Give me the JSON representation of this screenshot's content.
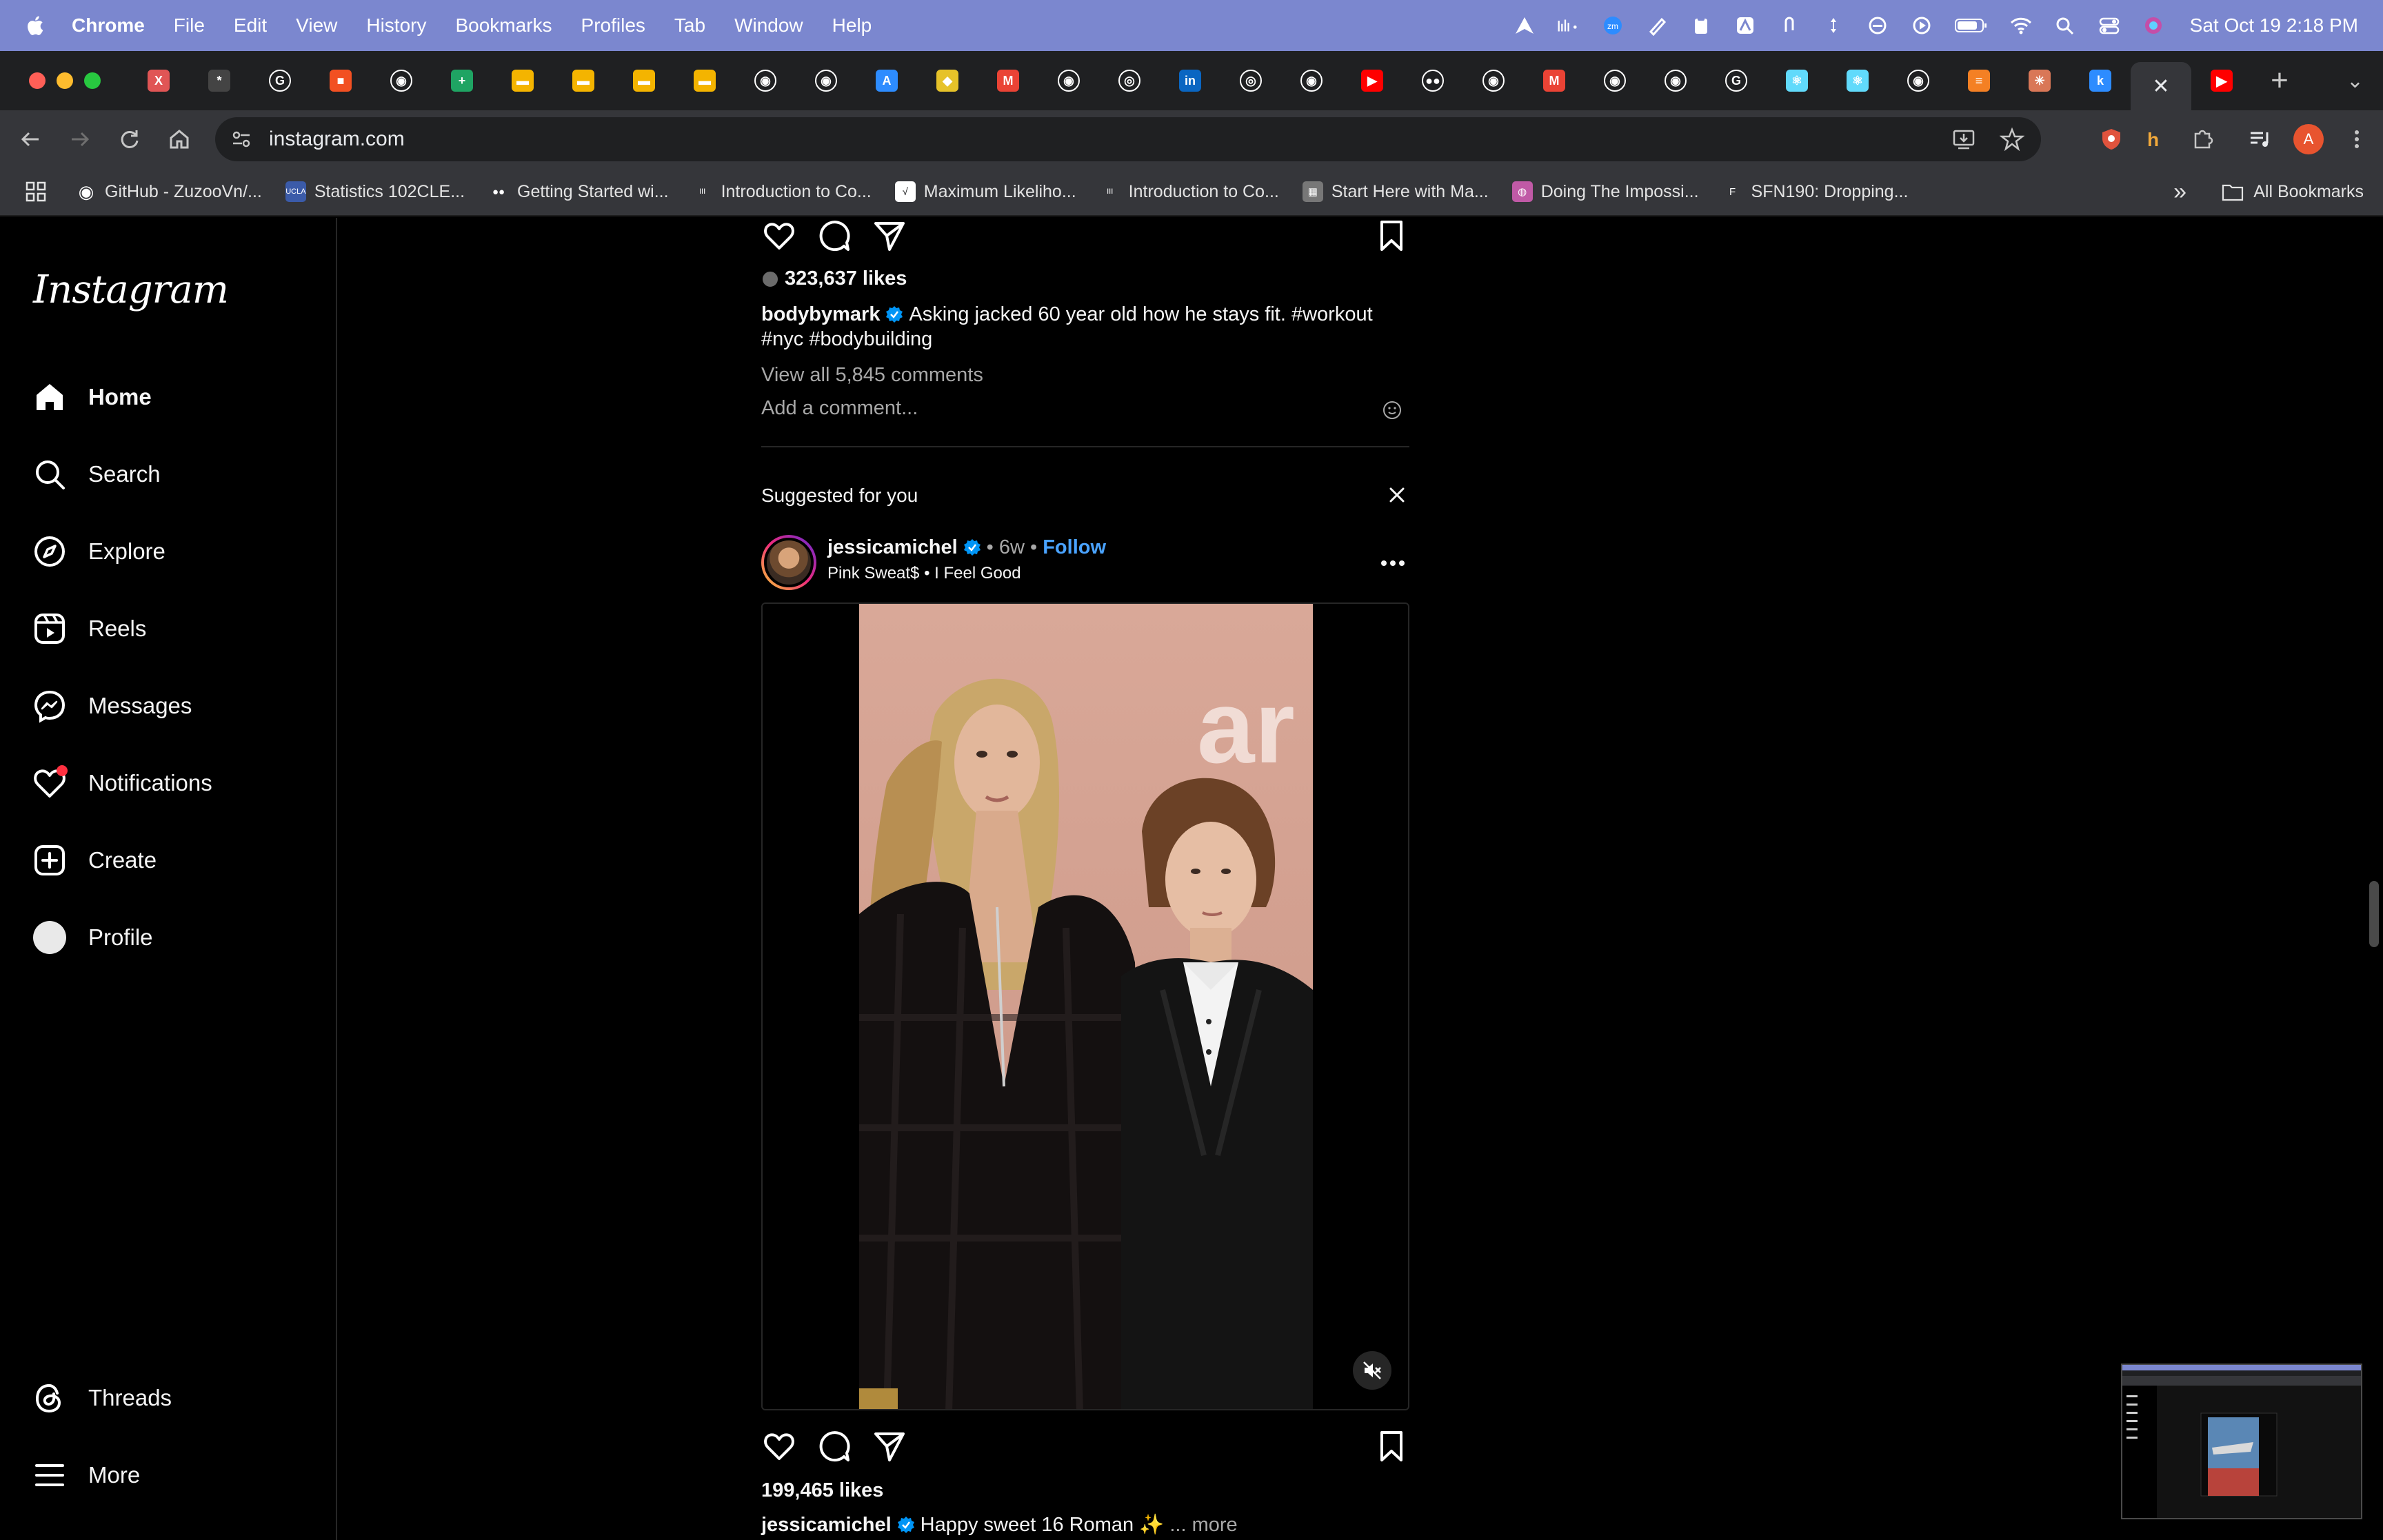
{
  "menubar": {
    "app_name": "Chrome",
    "items": [
      "File",
      "Edit",
      "View",
      "History",
      "Bookmarks",
      "Profiles",
      "Tab",
      "Window",
      "Help"
    ],
    "clock": "Sat Oct 19  2:18 PM",
    "status_icons": [
      "arrow-icon",
      "bars-icon",
      "zoom-icon",
      "pen-icon",
      "clipboard-icon",
      "maps-icon",
      "paperclip-icon",
      "updown-icon",
      "circle-icon",
      "play-icon",
      "battery-icon",
      "wifi-icon",
      "spotlight-icon",
      "control-center-icon",
      "siri-icon"
    ]
  },
  "tabs": {
    "favicons": [
      {
        "name": "x-tab",
        "color": "#e05555",
        "glyph": "X"
      },
      {
        "name": "spider-tab",
        "color": "#444444",
        "glyph": "*"
      },
      {
        "name": "google-tab",
        "color": "#ffffff",
        "glyph": "G"
      },
      {
        "name": "microsoft-tab",
        "color": "#f25022",
        "glyph": "■"
      },
      {
        "name": "github-tab",
        "color": "#ffffff",
        "glyph": "◉"
      },
      {
        "name": "sheets-tab",
        "color": "#1fa463",
        "glyph": "+"
      },
      {
        "name": "slides-tab",
        "color": "#f4b400",
        "glyph": "▬"
      },
      {
        "name": "slides-tab-2",
        "color": "#f4b400",
        "glyph": "▬"
      },
      {
        "name": "slides-tab-3",
        "color": "#f4b400",
        "glyph": "▬"
      },
      {
        "name": "slides-tab-4",
        "color": "#f4b400",
        "glyph": "▬"
      },
      {
        "name": "github-tab-2",
        "color": "#ffffff",
        "glyph": "◉"
      },
      {
        "name": "github-tab-3",
        "color": "#ffffff",
        "glyph": "◉"
      },
      {
        "name": "appstore-tab",
        "color": "#2d8cff",
        "glyph": "A"
      },
      {
        "name": "shield-tab",
        "color": "#e6c229",
        "glyph": "◆"
      },
      {
        "name": "gmail-tab",
        "color": "#ea4335",
        "glyph": "M"
      },
      {
        "name": "github-tab-4",
        "color": "#ffffff",
        "glyph": "◉"
      },
      {
        "name": "chrome-tab",
        "color": "#ffffff",
        "glyph": "◎"
      },
      {
        "name": "linkedin-tab",
        "color": "#0a66c2",
        "glyph": "in"
      },
      {
        "name": "chrome-tab-2",
        "color": "#ffffff",
        "glyph": "◎"
      },
      {
        "name": "github-tab-5",
        "color": "#ffffff",
        "glyph": "◉"
      },
      {
        "name": "youtube-tab",
        "color": "#ff0000",
        "glyph": "▶"
      },
      {
        "name": "medium-tab",
        "color": "#ffffff",
        "glyph": "●●"
      },
      {
        "name": "github-tab-6",
        "color": "#ffffff",
        "glyph": "◉"
      },
      {
        "name": "gmail-tab-2",
        "color": "#ea4335",
        "glyph": "M"
      },
      {
        "name": "github-tab-7",
        "color": "#ffffff",
        "glyph": "◉"
      },
      {
        "name": "github-tab-8",
        "color": "#ffffff",
        "glyph": "◉"
      },
      {
        "name": "google-tab-2",
        "color": "#ffffff",
        "glyph": "G"
      },
      {
        "name": "react-tab",
        "color": "#61dafb",
        "glyph": "⚛"
      },
      {
        "name": "react-tab-2",
        "color": "#61dafb",
        "glyph": "⚛"
      },
      {
        "name": "github-tab-9",
        "color": "#ffffff",
        "glyph": "◉"
      },
      {
        "name": "stack-tab",
        "color": "#f48024",
        "glyph": "≡"
      },
      {
        "name": "claude-tab",
        "color": "#d97757",
        "glyph": "✳"
      },
      {
        "name": "k-tab",
        "color": "#2d8cff",
        "glyph": "k"
      }
    ],
    "active_close": "✕",
    "after_active": {
      "name": "youtube-tab-2",
      "color": "#ff0000",
      "glyph": "▶"
    },
    "new_tab": "+",
    "dropdown": "⌄"
  },
  "toolbar": {
    "url": "instagram.com",
    "profile_initial": "A"
  },
  "bookmarks": {
    "items": [
      {
        "name": "bookmark-github",
        "label": "GitHub - ZuzooVn/...",
        "color": "#ffffff",
        "glyph": "◉"
      },
      {
        "name": "bookmark-statistics",
        "label": "Statistics 102CLE...",
        "color": "#3b5ba9",
        "glyph": "UCLA"
      },
      {
        "name": "bookmark-getting-started",
        "label": "Getting Started wi...",
        "color": "#000000",
        "glyph": "●●"
      },
      {
        "name": "bookmark-intro-co",
        "label": "Introduction to Co...",
        "color": "#000000",
        "glyph": "III"
      },
      {
        "name": "bookmark-max-likelihood",
        "label": "Maximum Likeliho...",
        "color": "#ffffff",
        "glyph": "√"
      },
      {
        "name": "bookmark-intro-co-2",
        "label": "Introduction to Co...",
        "color": "#000000",
        "glyph": "III"
      },
      {
        "name": "bookmark-start-here",
        "label": "Start Here with Ma...",
        "color": "#777777",
        "glyph": "▦"
      },
      {
        "name": "bookmark-doing-impossible",
        "label": "Doing The Impossi...",
        "color": "#c05aa6",
        "glyph": "◍"
      },
      {
        "name": "bookmark-sfn190",
        "label": "SFN190: Dropping...",
        "color": "#000000",
        "glyph": "F"
      }
    ],
    "overflow": "»",
    "all_bookmarks": "All Bookmarks"
  },
  "instagram": {
    "logo": "Instagram",
    "nav": [
      {
        "name": "nav-home",
        "icon": "home-icon",
        "label": "Home",
        "active": true
      },
      {
        "name": "nav-search",
        "icon": "search-icon",
        "label": "Search"
      },
      {
        "name": "nav-explore",
        "icon": "compass-icon",
        "label": "Explore"
      },
      {
        "name": "nav-reels",
        "icon": "reels-icon",
        "label": "Reels"
      },
      {
        "name": "nav-messages",
        "icon": "messenger-icon",
        "label": "Messages"
      },
      {
        "name": "nav-notifications",
        "icon": "heart-icon",
        "label": "Notifications",
        "badge": true
      },
      {
        "name": "nav-create",
        "icon": "plus-square-icon",
        "label": "Create"
      },
      {
        "name": "nav-profile",
        "icon": "profile-avatar-icon",
        "label": "Profile"
      }
    ],
    "bottom_nav": [
      {
        "name": "nav-threads",
        "icon": "threads-icon",
        "label": "Threads"
      },
      {
        "name": "nav-more",
        "icon": "hamburger-icon",
        "label": "More"
      }
    ]
  },
  "post1": {
    "likes": "323,637 likes",
    "username": "bodybymark",
    "caption": "Asking jacked 60 year old how he stays fit. #workout #nyc #bodybuilding",
    "view_comments": "View all 5,845 comments",
    "add_comment_placeholder": "Add a comment..."
  },
  "suggested": {
    "heading": "Suggested for you",
    "close": "✕"
  },
  "post2": {
    "username": "jessicamichel",
    "separator": "•",
    "age": "6w",
    "follow": "Follow",
    "audio_artist": "Pink Sweat$",
    "audio_track": "I Feel Good",
    "likes": "199,465 likes",
    "caption": "Happy sweet 16 Roman ✨",
    "more": "... more"
  },
  "colors": {
    "menubar": "#7b87cf",
    "tabstrip": "#1f2022",
    "toolbar": "#35363a",
    "ig_background": "#000000",
    "follow_blue": "#4aa3ff",
    "verified_blue": "#0095f6",
    "notification_dot": "#ff3040"
  }
}
